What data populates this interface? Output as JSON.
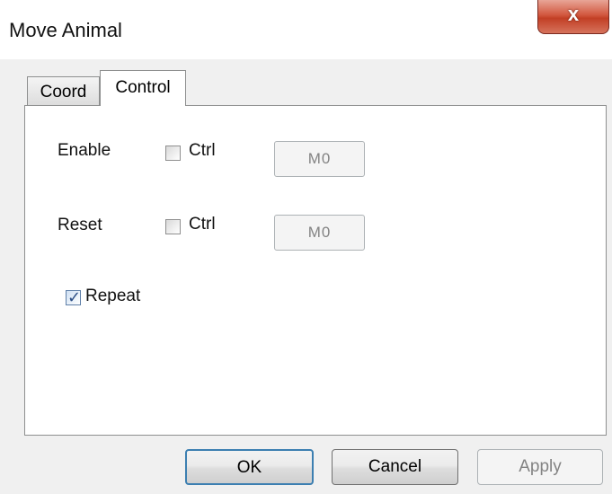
{
  "window": {
    "title": "Move Animal",
    "close_glyph": "x"
  },
  "tabs": [
    {
      "label": "Coord",
      "active": false
    },
    {
      "label": "Control",
      "active": true
    }
  ],
  "control": {
    "enable": {
      "label": "Enable",
      "ctrl_label": "Ctrl",
      "ctrl_checked": false,
      "address": "M0"
    },
    "reset": {
      "label": "Reset",
      "ctrl_label": "Ctrl",
      "ctrl_checked": false,
      "address": "M0"
    },
    "repeat": {
      "label": "Repeat",
      "checked": true
    }
  },
  "buttons": {
    "ok": "OK",
    "cancel": "Cancel",
    "apply": "Apply"
  },
  "icons": {
    "close": "close-icon",
    "check": "checkmark-icon"
  },
  "colors": {
    "close_button": "#c94a31",
    "default_button_border": "#3c7fb1",
    "disabled_text": "#838383"
  }
}
